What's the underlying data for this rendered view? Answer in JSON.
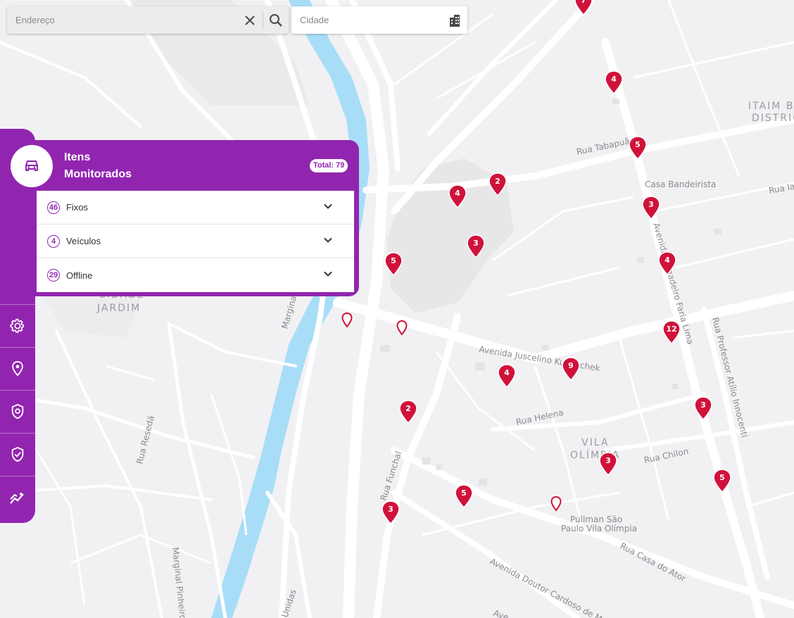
{
  "search": {
    "address_placeholder": "Endereço",
    "city_placeholder": "Cidade"
  },
  "icons": {
    "clear": "close-icon",
    "search": "search-icon",
    "city": "city-icon",
    "vehicle": "car-icon",
    "settings": "gear-icon",
    "location": "location-pin-icon",
    "fence": "shield-location-icon",
    "security": "shield-check-icon",
    "analytics": "analytics-icon"
  },
  "colors": {
    "brand": "#9225b0",
    "marker": "#d0123a"
  },
  "panel": {
    "title_line1": "Itens",
    "title_line2": "Monitorados",
    "total": "Total: 79",
    "rows": [
      {
        "count": "46",
        "label": "Fixos"
      },
      {
        "count": "4",
        "label": "Veículos"
      },
      {
        "count": "29",
        "label": "Offline"
      }
    ]
  },
  "map": {
    "labels": {
      "district_itaim_1": "ITAIM B",
      "district_itaim_2": "DISTRIC",
      "district_cidade_1": "CIDADE",
      "district_cidade_2": "JARDIM",
      "district_vila_1": "VILA",
      "district_vila_2": "OLÍMPIA",
      "rua_tabapua": "Rua Tabapuã",
      "casa_bandeirista": "Casa Bandeirista",
      "rua_iai": "Rua Iai",
      "av_faria_lima": "Avenida Brigadeiro Faria Lima",
      "av_jk": "Avenida Juscelino Kubitschek",
      "rua_prof_atilio": "Rua Professor Atílio Innocenti",
      "rua_helena": "Rua Helena",
      "rua_chilon": "Rua Chilon",
      "rua_funchal": "Rua Funchal",
      "pullman_1": "Pullman São",
      "pullman_2": "Paulo Vila Olímpia",
      "rua_casa_ator": "Rua Casa do Ator",
      "av_cardoso": "Avenida Doutor Cardoso de Melo",
      "marginal_left": "Marginal Pinheiros",
      "marginal_center": "Marginal",
      "rua_reseda": "Rua Resedá",
      "unidas": "Unidas",
      "av_bottom": "Ave"
    },
    "markers": [
      {
        "count": "7"
      },
      {
        "count": "4"
      },
      {
        "count": "5"
      },
      {
        "count": "2"
      },
      {
        "count": "4"
      },
      {
        "count": "3"
      },
      {
        "count": "3"
      },
      {
        "count": "5"
      },
      {
        "count": "4"
      },
      {
        "count": "12"
      },
      {
        "count": "9"
      },
      {
        "count": "4"
      },
      {
        "count": "2"
      },
      {
        "count": "3"
      },
      {
        "count": "3"
      },
      {
        "count": "5"
      },
      {
        "count": "5"
      },
      {
        "count": "3"
      }
    ]
  }
}
